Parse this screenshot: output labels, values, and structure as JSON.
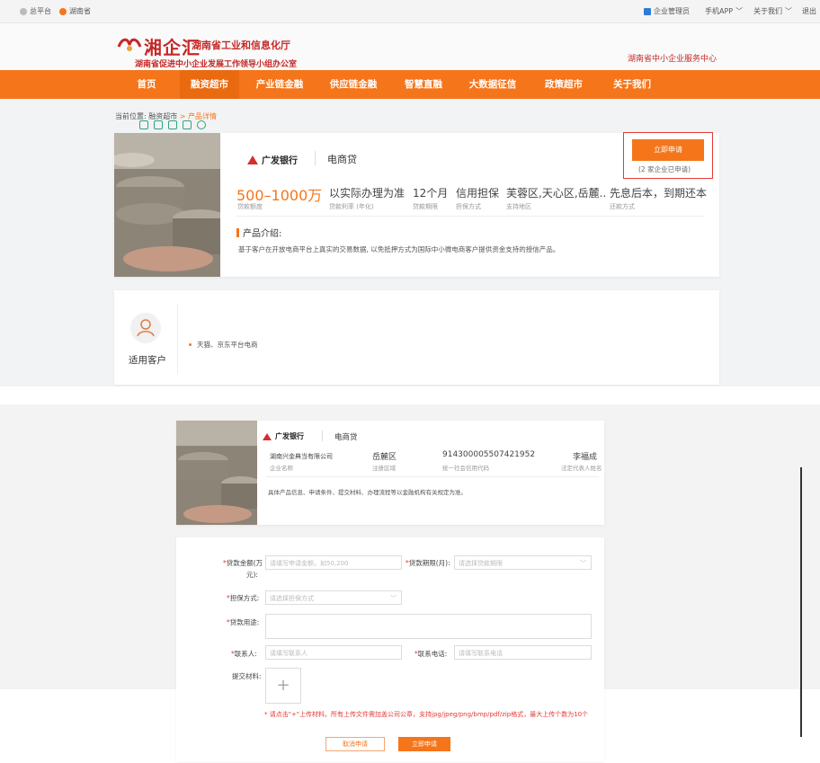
{
  "topbar": {
    "platform": "总平台",
    "province": "湖南省",
    "enterprise_admin": "企业管理员",
    "mobile": "手机APP",
    "about": "关于我们",
    "logout": "退出"
  },
  "header": {
    "script_logo": "湘企汇",
    "org_name": "湖南省工业和信息化厅",
    "org_sub": "湖南省促进中小企业发展工作领导小组办公室",
    "service_center": "湖南省中小企业服务中心"
  },
  "nav": [
    "首页",
    "融资超市",
    "产业链金融",
    "供应链金融",
    "智慧直融",
    "大数据征信",
    "政策超市",
    "关于我们"
  ],
  "breadcrumb": {
    "prefix": "当前位置:",
    "link": "融资超市",
    "sep": ">",
    "current": "产品详情"
  },
  "product": {
    "bank": "广发银行",
    "product_name": "电商贷",
    "apply_label": "立即申请",
    "apply_count": "(2 家企业已申请)",
    "amount": "500–1000万",
    "amount_label": "贷款额度",
    "rate": "以实际办理为准",
    "rate_label": "贷款利率 (年化)",
    "term": "12个月",
    "term_label": "贷款期限",
    "guarantee": "信用担保",
    "guarantee_label": "担保方式",
    "region": "芙蓉区,天心区,岳麓..",
    "region_label": "支持地区",
    "repay": "先息后本，到期还本",
    "repay_label": "还款方式",
    "intro_title": "产品介绍:",
    "intro_text": "基于客户在开放电商平台上真实的交易数据, 以免抵押方式为国际中小微电商客户提供资金支持的授信产品。"
  },
  "customers": {
    "title": "适用客户",
    "item": "天猫、京东平台电商"
  },
  "company": {
    "bank": "广发银行",
    "product_name": "电商贷",
    "name": "湖南兴金典当有限公司",
    "name_label": "企业名称",
    "district": "岳麓区",
    "district_label": "注册区域",
    "credit_code": "914300005507421952",
    "credit_code_label": "统一社会信用代码",
    "legal_rep": "李福成",
    "legal_rep_label": "法定代表人姓名",
    "notice": "具体产品信息、申请条件、提交材料、办理流程等以金融机构有关规定为准。"
  },
  "form": {
    "amount_label_1": "贷款金额(万",
    "amount_label_2": "元):",
    "amount_placeholder": "请填写申请金额，如50,200",
    "term_label": "贷款期限(月):",
    "term_placeholder": "请选择贷款期限",
    "guarantee_label": "担保方式:",
    "guarantee_placeholder": "请选择担保方式",
    "purpose_label": "贷款用途:",
    "contact_label": "联系人:",
    "contact_placeholder": "请填写联系人",
    "phone_label": "联系电话:",
    "phone_placeholder": "请填写联系电话",
    "materials_label": "提交材料:",
    "upload_plus": "+",
    "note": "* 请点击\"+\"上传材料。所有上传文件需加盖公司公章，支持jpg/jpeg/png/bmp/pdf/zip格式，最大上传个数为10个",
    "cancel": "取消申请",
    "submit": "立即申请"
  },
  "colors": {
    "brand_orange": "#f5751a",
    "brand_red": "#c62828",
    "highlight_red": "#e53935"
  }
}
